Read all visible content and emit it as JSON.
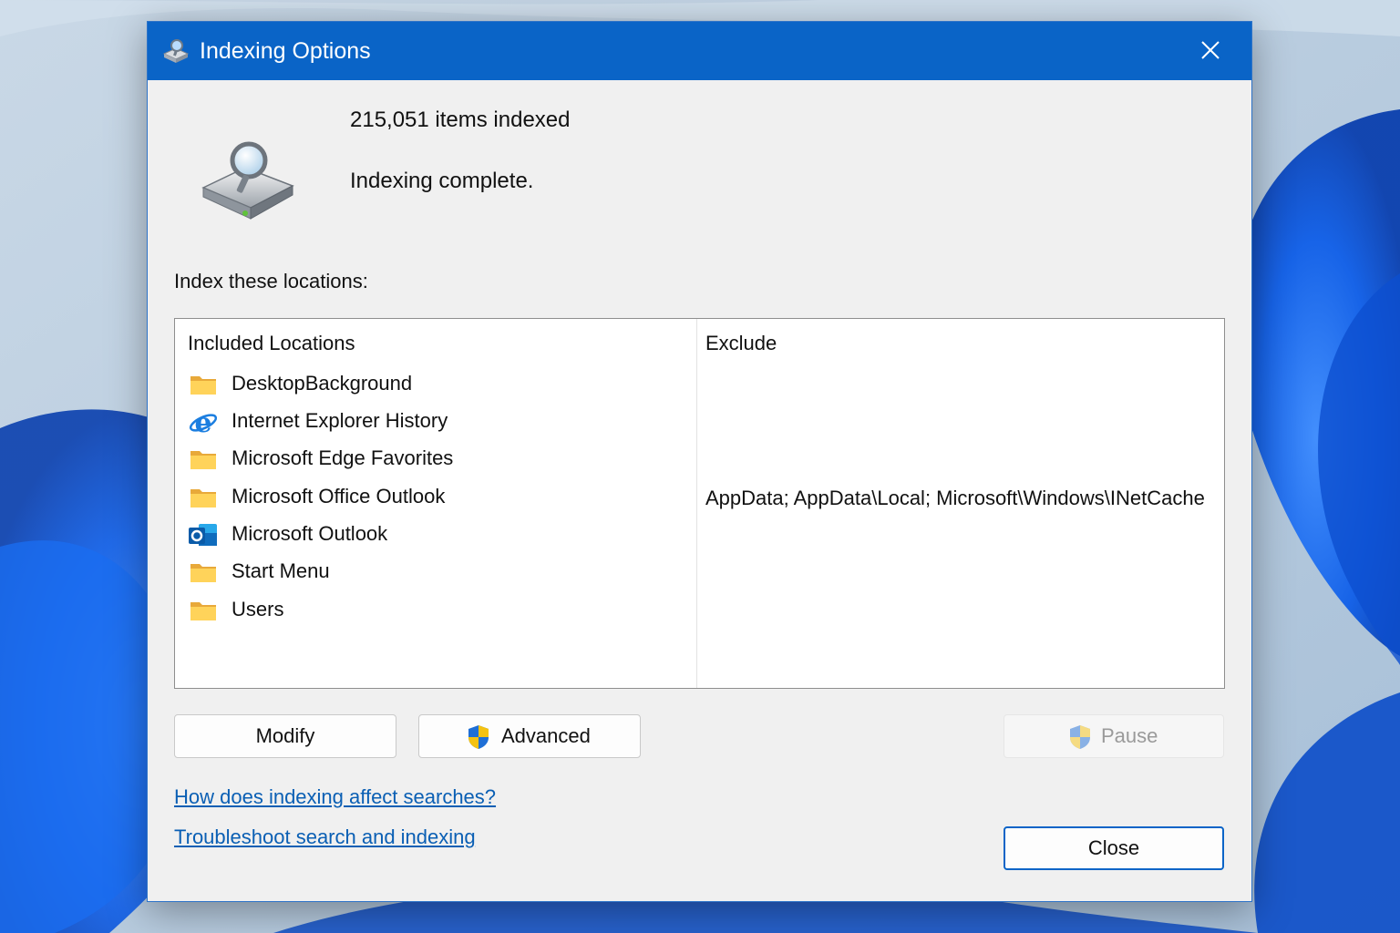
{
  "window": {
    "title": "Indexing Options"
  },
  "status": {
    "items_indexed": "215,051 items indexed",
    "message": "Indexing complete."
  },
  "locations": {
    "label": "Index these locations:",
    "columns": {
      "included": "Included Locations",
      "exclude": "Exclude"
    },
    "rows": [
      {
        "name": "DesktopBackground",
        "icon": "folder-icon",
        "exclude": ""
      },
      {
        "name": "Internet Explorer History",
        "icon": "internet-explorer-icon",
        "exclude": ""
      },
      {
        "name": "Microsoft Edge Favorites",
        "icon": "folder-icon",
        "exclude": ""
      },
      {
        "name": "Microsoft Office Outlook",
        "icon": "folder-icon",
        "exclude": "AppData; AppData\\Local; Microsoft\\Windows\\INetCache"
      },
      {
        "name": "Microsoft Outlook",
        "icon": "outlook-icon",
        "exclude": ""
      },
      {
        "name": "Start Menu",
        "icon": "folder-icon",
        "exclude": ""
      },
      {
        "name": "Users",
        "icon": "folder-icon",
        "exclude": ""
      }
    ]
  },
  "buttons": {
    "modify": "Modify",
    "advanced": "Advanced",
    "pause": "Pause",
    "close": "Close"
  },
  "links": {
    "how_indexing": "How does indexing affect searches?",
    "troubleshoot": "Troubleshoot search and indexing"
  },
  "colors": {
    "titlebar": "#0a64c7",
    "link": "#0a5fb4",
    "dialog_background": "#f0f0f0"
  }
}
